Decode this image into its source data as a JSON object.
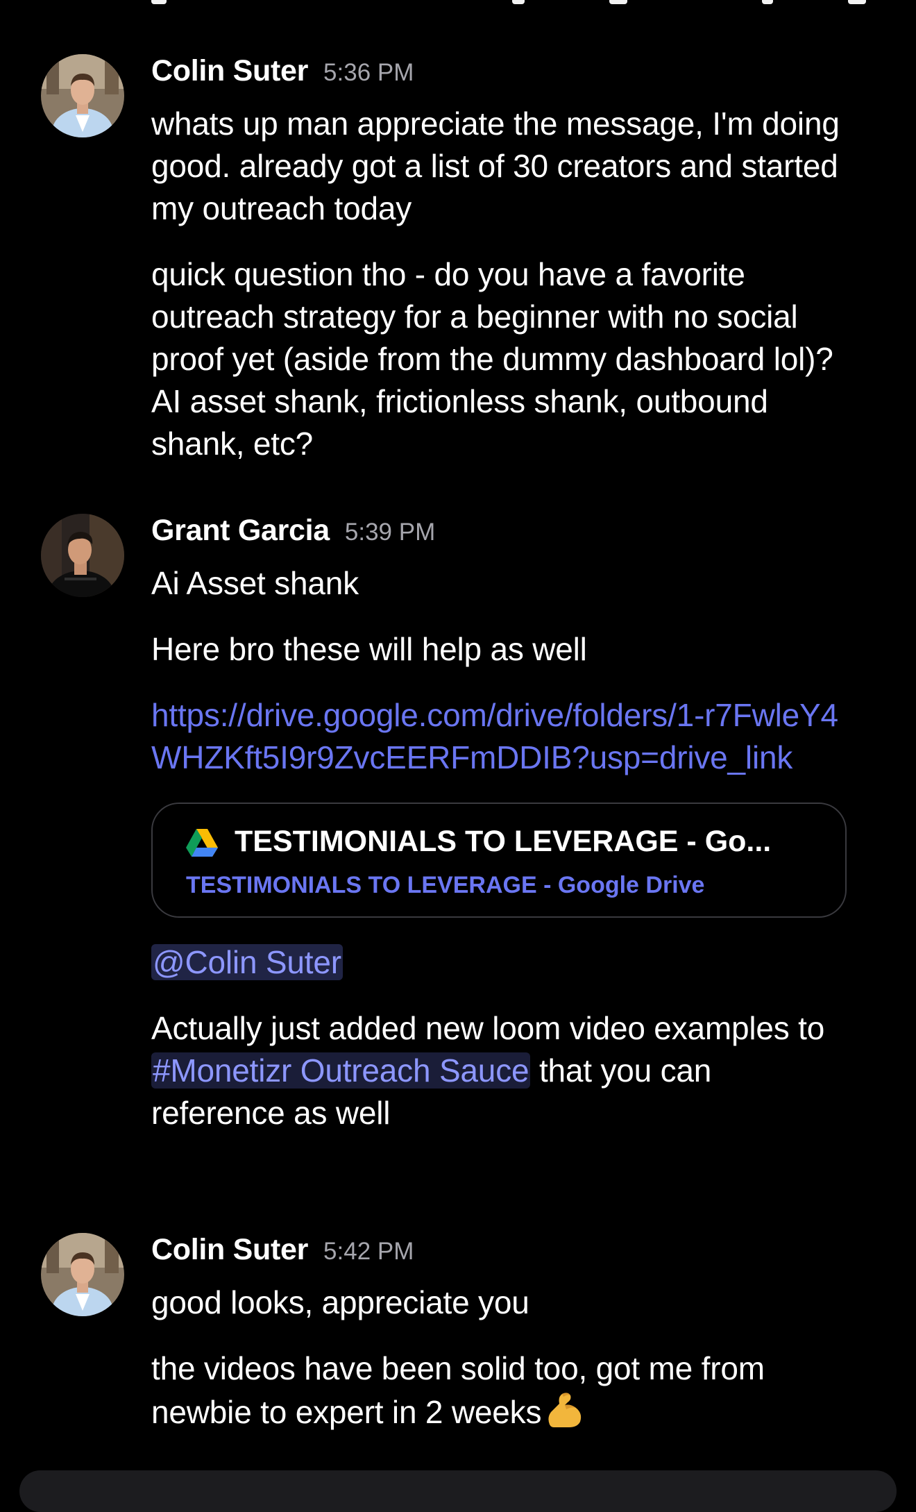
{
  "messages": [
    {
      "author": "Colin Suter",
      "time": "5:36 PM",
      "paragraphs": [
        "whats up man appreciate the message, I'm doing good. already got a list of 30 creators and started my outreach today",
        "quick question tho - do you have a favorite outreach strategy for a beginner with no social proof yet (aside from the dummy dashboard lol)? AI asset shank, frictionless shank, outbound shank, etc?"
      ]
    },
    {
      "author": "Grant Garcia",
      "time": "5:39 PM",
      "paragraphs": [
        "Ai Asset shank",
        "Here bro these will help as well"
      ],
      "link": "https://drive.google.com/drive/folders/1-r7FwleY4WHZKft5I9r9ZvcEERFmDDIB?usp=drive_link",
      "embed": {
        "icon": "google-drive-icon",
        "title": "TESTIMONIALS TO LEVERAGE - Go...",
        "subtitle": "TESTIMONIALS TO LEVERAGE - Google Drive"
      },
      "mention": "@Colin Suter",
      "last_paragraph": {
        "before": "Actually just added new loom video examples to ",
        "channel": "#Monetizr Outreach Sauce",
        "after": " that you can reference as well"
      }
    },
    {
      "author": "Colin Suter",
      "time": "5:42 PM",
      "paragraphs": [
        "good looks, appreciate you",
        "the videos have been solid too, got me from newbie to expert in 2 weeks"
      ],
      "emoji": "flexed-biceps-icon"
    }
  ],
  "colors": {
    "background": "#000000",
    "link": "#6a76f2",
    "mention_bg": "#202445",
    "timestamp": "#a6a6ad"
  }
}
